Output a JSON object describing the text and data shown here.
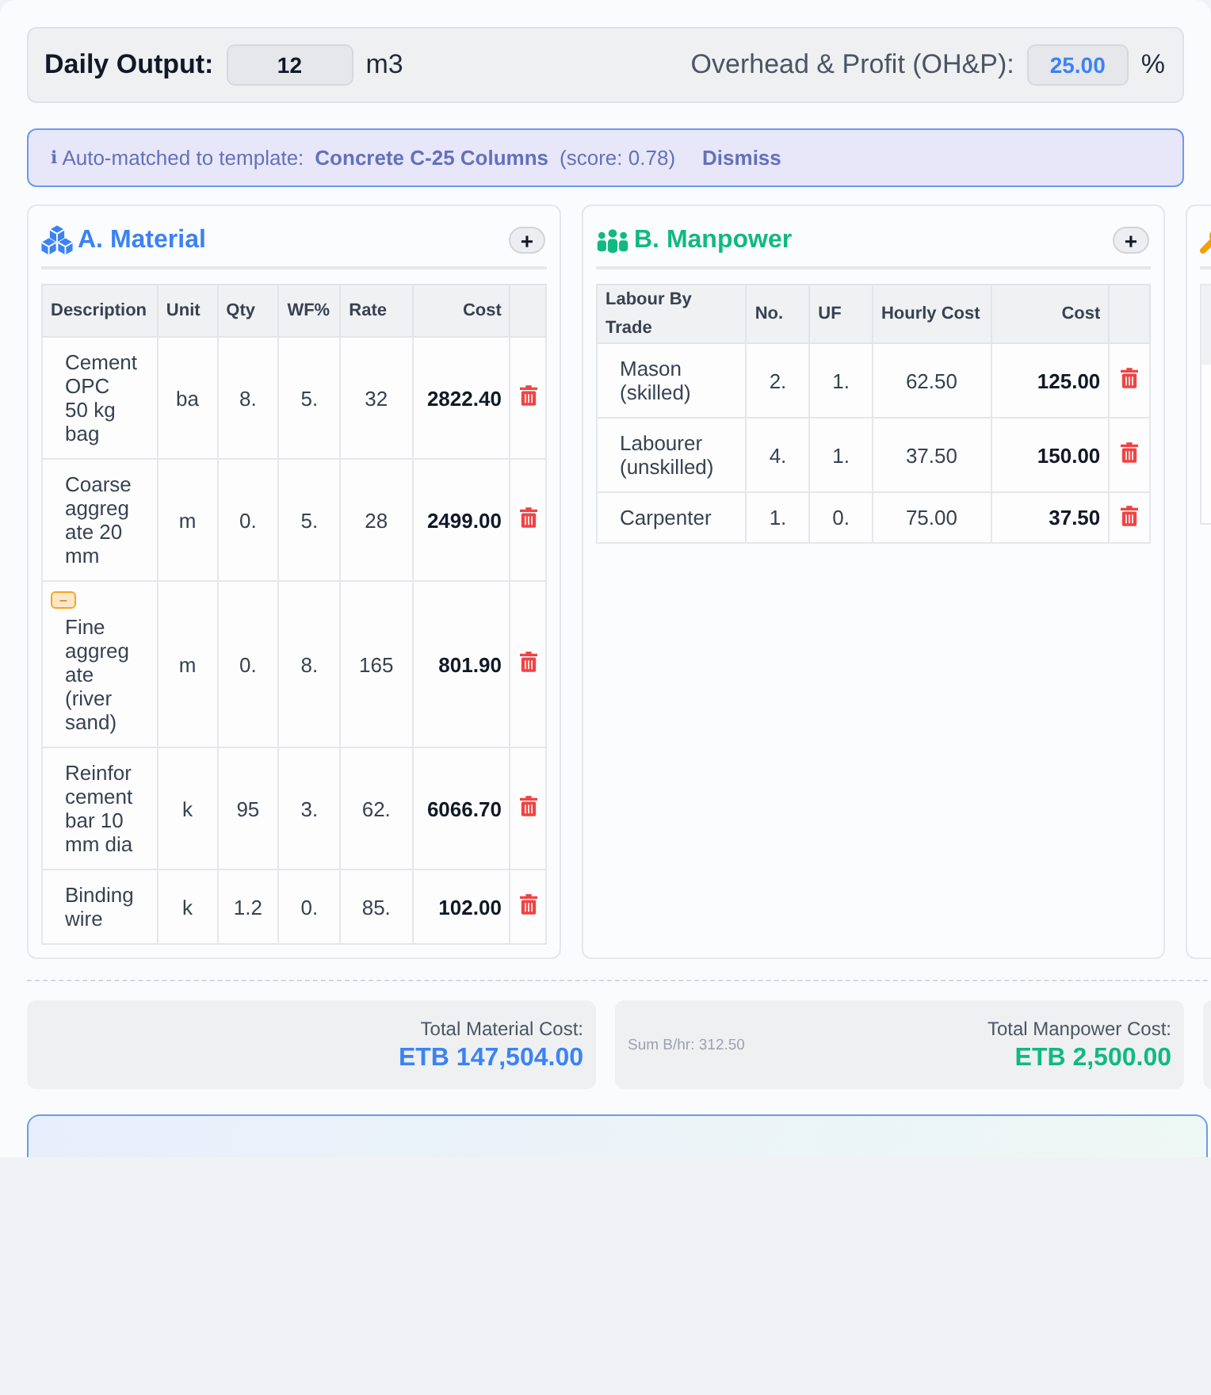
{
  "header": {
    "output_label": "Daily Output:",
    "output_value": "12",
    "output_unit": "m3",
    "ohp_label": "Overhead & Profit (OH&P):",
    "ohp_value": "25.00",
    "ohp_unit": "%"
  },
  "banner": {
    "icon": "ℹ",
    "label": "Auto-matched to template:",
    "template": "Concrete C-25 Columns",
    "score": "(score: 0.78)",
    "dismiss": "Dismiss"
  },
  "panels": [
    {
      "kind": "material",
      "title": "A. Material",
      "add": "+",
      "columns": [
        {
          "label": "Description",
          "kind": "text"
        },
        {
          "label": "Unit",
          "kind": "field"
        },
        {
          "label": "Qty",
          "kind": "field"
        },
        {
          "label": "WF%",
          "kind": "field"
        },
        {
          "label": "Rate",
          "kind": "field"
        },
        {
          "label": "Cost",
          "kind": "amount"
        }
      ],
      "rows": [
        {
          "cells": [
            "Cement OPC 50 kg bag",
            "ba",
            "8.",
            "5.",
            "32",
            "2822.40"
          ]
        },
        {
          "cells": [
            "Coarse aggregate 20 mm",
            "m",
            "0.",
            "5.",
            "28",
            "2499.00"
          ]
        },
        {
          "badge": "–",
          "cells": [
            "Fine aggregate (river sand)",
            "m",
            "0.",
            "8.",
            "165",
            "801.90"
          ]
        },
        {
          "cells": [
            "Reinforcement bar 10 mm dia",
            "k",
            "95",
            "3.",
            "62.",
            "6066.70"
          ]
        },
        {
          "cells": [
            "Binding wire",
            "k",
            "1.2",
            "0.",
            "85.",
            "102.00"
          ]
        }
      ]
    },
    {
      "kind": "manpower",
      "title": "B. Manpower",
      "add": "+",
      "columns": [
        {
          "label": "Labour By Trade",
          "kind": "text"
        },
        {
          "label": "No.",
          "kind": "field"
        },
        {
          "label": "UF",
          "kind": "field"
        },
        {
          "label": "Hourly Cost",
          "kind": "number"
        },
        {
          "label": "Cost",
          "kind": "amount"
        }
      ],
      "rows": [
        {
          "cells": [
            "Mason (skilled)",
            "2.",
            "1.",
            "62.50",
            "125.00"
          ]
        },
        {
          "cells": [
            "Labourer (unskilled)",
            "4.",
            "1.",
            "37.50",
            "150.00"
          ]
        },
        {
          "cells": [
            "Carpenter",
            "1.",
            "0.",
            "75.00",
            "37.50"
          ]
        }
      ]
    },
    {
      "kind": "clipped"
    }
  ],
  "totals": [
    {
      "kind": "material",
      "label": "Total Material Cost:",
      "value": "ETB 147,504.00"
    },
    {
      "kind": "manpower",
      "note": "Sum B/hr: 312.50",
      "label": "Total Manpower Cost:",
      "value": "ETB 2,500.00"
    },
    {
      "kind": "clipped"
    }
  ]
}
